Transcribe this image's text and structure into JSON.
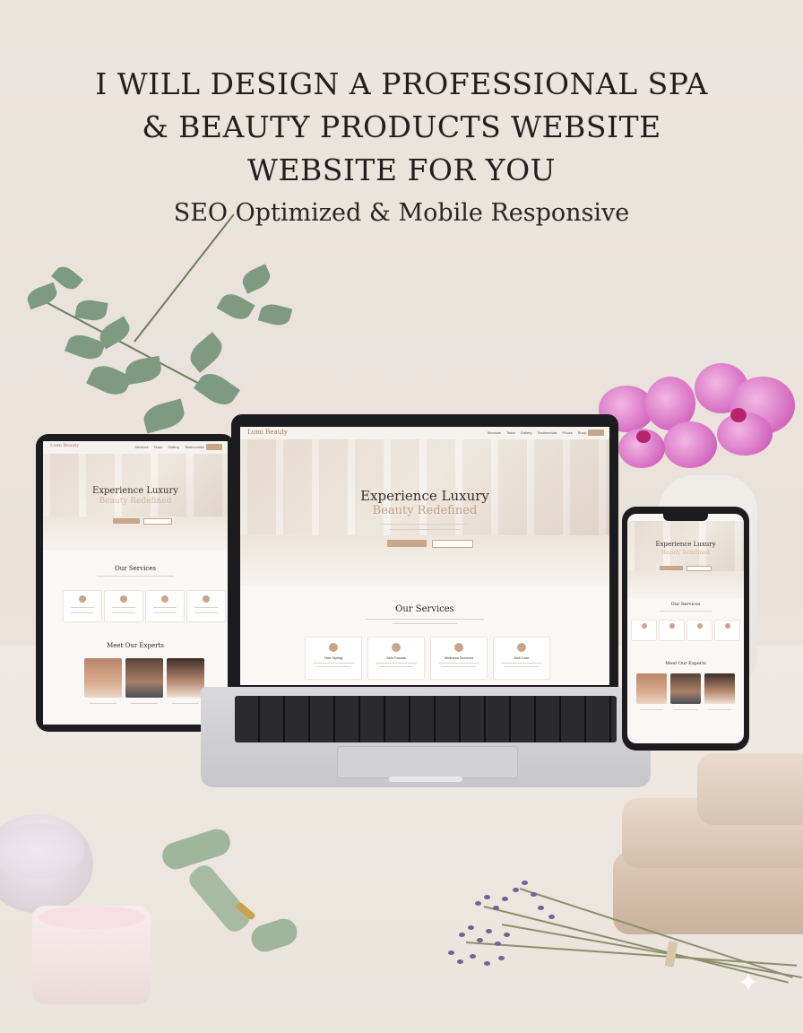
{
  "heading": {
    "line1": "I WILL DESIGN A PROFESSIONAL SPA",
    "line2": "& BEAUTY PRODUCTS WEBSITE",
    "line3": "WEBSITE FOR YOU",
    "subtitle": "SEO Optimized & Mobile Responsive"
  },
  "mockup": {
    "brand_logo": "Lumi Beauty",
    "nav_items": [
      "Services",
      "Team",
      "Gallery",
      "Testimonials",
      "Prices",
      "Shop"
    ],
    "laptop": {
      "hero_title": "Experience Luxury",
      "hero_subtitle": "Beauty Redefined",
      "services_title": "Our Services",
      "services": [
        "Hair Styling",
        "Skin Facials",
        "Wellness Services",
        "Nail Care"
      ]
    },
    "tablet": {
      "hero_title": "Experience Luxury",
      "services_title": "Our Services",
      "experts_title": "Meet Our Experts"
    },
    "phone": {
      "hero_title": "Experience Luxury",
      "services_title": "Our Services",
      "experts_title": "Meet Our Experts"
    }
  },
  "colors": {
    "background": "#ece5de",
    "accent": "#c9a58a",
    "device_frame": "#1c1c1e"
  }
}
